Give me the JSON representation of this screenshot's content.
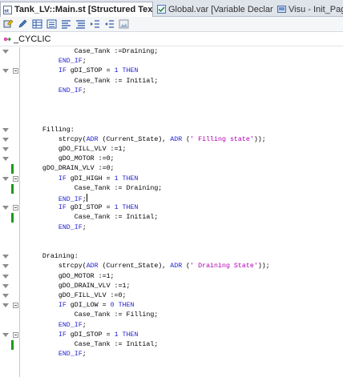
{
  "tabs": [
    {
      "label": "Tank_LV::Main.st [Structured Text]",
      "active": true,
      "icon": "st-file-icon",
      "has_close": true
    },
    {
      "label": "Global.var [Variable Declaration]",
      "active": false,
      "icon": "var-file-icon"
    },
    {
      "label": "Visu - Init_Page [V",
      "active": false,
      "icon": "visu-file-icon"
    }
  ],
  "toolbar": {
    "buttons": [
      "insert-icon",
      "pencil-icon",
      "table-icon",
      "list-icon",
      "align-icon",
      "comment-icon",
      "indent-icon",
      "outdent-icon",
      "image-icon"
    ]
  },
  "section": {
    "label": "_CYCLIC",
    "icon": "cyclic-arrow-icon"
  },
  "code": {
    "lines": [
      {
        "text": "            Case_Tank :=Draining;",
        "arrow": true,
        "fold": false,
        "change": false
      },
      {
        "text": "        END_IF;",
        "arrow": false,
        "fold": false,
        "change": false
      },
      {
        "text": "        IF gDI_STOP = 1 THEN",
        "arrow": true,
        "fold": true,
        "change": false
      },
      {
        "text": "            Case_Tank := Initial;",
        "arrow": false,
        "fold": false,
        "change": false
      },
      {
        "text": "        END_IF;",
        "arrow": false,
        "fold": false,
        "change": false
      },
      {
        "text": "",
        "arrow": false,
        "fold": false,
        "change": false
      },
      {
        "text": "",
        "arrow": false,
        "fold": false,
        "change": false
      },
      {
        "text": "",
        "arrow": false,
        "fold": false,
        "change": false
      },
      {
        "text": "    Filling:",
        "arrow": true,
        "fold": false,
        "change": false
      },
      {
        "text": "        strcpy(ADR (Current_State), ADR (' Filling state'));",
        "arrow": true,
        "fold": false,
        "change": false
      },
      {
        "text": "        gDO_FILL_VLV :=1;",
        "arrow": true,
        "fold": false,
        "change": false
      },
      {
        "text": "        gDO_MOTOR :=0;",
        "arrow": true,
        "fold": false,
        "change": false
      },
      {
        "text": "    gDO_DRAIN_VLV :=0;",
        "arrow": false,
        "fold": false,
        "change": true
      },
      {
        "text": "        IF gDI_HIGH = 1 THEN",
        "arrow": true,
        "fold": true,
        "change": false
      },
      {
        "text": "            Case_Tank := Draining;",
        "arrow": false,
        "fold": false,
        "change": true
      },
      {
        "text": "        END_IF;",
        "arrow": false,
        "fold": false,
        "change": false,
        "caret": true
      },
      {
        "text": "        IF gDI_STOP = 1 THEN",
        "arrow": true,
        "fold": true,
        "change": false
      },
      {
        "text": "            Case_Tank := Initial;",
        "arrow": false,
        "fold": false,
        "change": true
      },
      {
        "text": "        END_IF;",
        "arrow": false,
        "fold": false,
        "change": false
      },
      {
        "text": "",
        "arrow": false,
        "fold": false,
        "change": false
      },
      {
        "text": "",
        "arrow": false,
        "fold": false,
        "change": false
      },
      {
        "text": "    Draining:",
        "arrow": true,
        "fold": false,
        "change": false
      },
      {
        "text": "        strcpy(ADR (Current_State), ADR (' Draining State'));",
        "arrow": true,
        "fold": false,
        "change": false
      },
      {
        "text": "        gDO_MOTOR :=1;",
        "arrow": true,
        "fold": false,
        "change": false
      },
      {
        "text": "        gDO_DRAIN_VLV :=1;",
        "arrow": true,
        "fold": false,
        "change": false
      },
      {
        "text": "        gDO_FILL_VLV :=0;",
        "arrow": true,
        "fold": false,
        "change": false
      },
      {
        "text": "        IF gDI_LOW = 0 THEN",
        "arrow": true,
        "fold": true,
        "change": false
      },
      {
        "text": "            Case_Tank := Filling;",
        "arrow": false,
        "fold": false,
        "change": false
      },
      {
        "text": "        END_IF;",
        "arrow": false,
        "fold": false,
        "change": false
      },
      {
        "text": "        IF gDI_STOP = 1 THEN",
        "arrow": true,
        "fold": true,
        "change": false
      },
      {
        "text": "            Case_Tank := Initial;",
        "arrow": false,
        "fold": false,
        "change": true
      },
      {
        "text": "        END_IF;",
        "arrow": false,
        "fold": false,
        "change": false
      }
    ]
  },
  "colors": {
    "keyword": "#1f1fcf",
    "string": "#b000b0",
    "change_marker": "#1a9a1a",
    "tab_bar": "#dfe3ea"
  }
}
